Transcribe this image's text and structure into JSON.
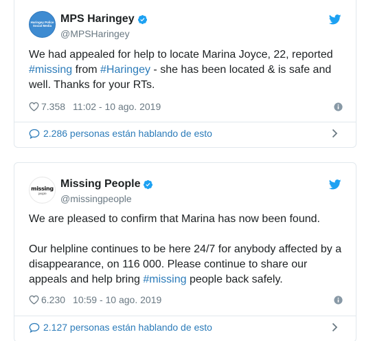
{
  "tweets": [
    {
      "display_name": "MPS Haringey",
      "handle": "@MPSHaringey",
      "avatar_text": [
        "Haringey Police",
        "Social Media"
      ],
      "text_segments": [
        {
          "t": "We had appealed for help to locate Marina Joyce, 22, reported "
        },
        {
          "t": "#missing",
          "hashtag": true
        },
        {
          "t": " from "
        },
        {
          "t": "#Haringey",
          "hashtag": true
        },
        {
          "t": " - she has been located & is safe and well. Thanks for your RTs."
        }
      ],
      "likes": "7.358",
      "timestamp": "11:02 - 10 ago. 2019",
      "conversation": "2.286 personas están hablando de esto"
    },
    {
      "display_name": "Missing People",
      "handle": "@missingpeople",
      "avatar_text": [
        "missing",
        "people"
      ],
      "paragraph_1": "We are pleased to confirm that Marina has now been found.",
      "paragraph_2_segments": [
        {
          "t": "Our helpline continues to be here 24/7 for anybody affected by a disappearance, on 116 000. Please continue to share our appeals and help bring "
        },
        {
          "t": "#missing",
          "hashtag": true
        },
        {
          "t": " people back safely."
        }
      ],
      "likes": "6.230",
      "timestamp": "10:59 - 10 ago. 2019",
      "conversation": "2.127 personas están hablando de esto"
    }
  ],
  "colors": {
    "link": "#2b7bb9",
    "verified": "#1da1f2",
    "twitter_bird": "#1da1f2",
    "meta_text": "#697882",
    "border": "#e1e8ed"
  },
  "icons": [
    "verified-badge-icon",
    "twitter-bird-icon",
    "heart-icon",
    "info-icon",
    "comment-bubble-icon",
    "chevron-right-icon"
  ]
}
